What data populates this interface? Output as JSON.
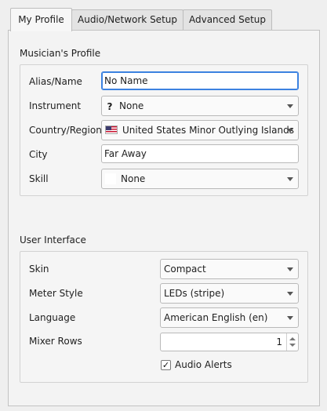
{
  "tabs": [
    {
      "label": "My Profile",
      "active": true
    },
    {
      "label": "Audio/Network Setup",
      "active": false
    },
    {
      "label": "Advanced Setup",
      "active": false
    }
  ],
  "profile": {
    "section_title": "Musician's Profile",
    "alias_label": "Alias/Name",
    "alias_value": "No Name",
    "instrument_label": "Instrument",
    "instrument_icon": "question-mark-icon",
    "instrument_value": "None",
    "country_label": "Country/Region",
    "country_icon": "us-flag-icon",
    "country_value": "United States Minor Outlying Islands",
    "city_label": "City",
    "city_value": "Far Away",
    "skill_label": "Skill",
    "skill_value": "None"
  },
  "ui": {
    "section_title": "User Interface",
    "skin_label": "Skin",
    "skin_value": "Compact",
    "meter_label": "Meter Style",
    "meter_value": "LEDs (stripe)",
    "language_label": "Language",
    "language_value": "American English (en)",
    "mixer_rows_label": "Mixer Rows",
    "mixer_rows_value": "1",
    "audio_alerts_label": "Audio Alerts",
    "audio_alerts_checked": true
  },
  "colors": {
    "focus_border": "#3c82e0",
    "background": "#efefef"
  }
}
